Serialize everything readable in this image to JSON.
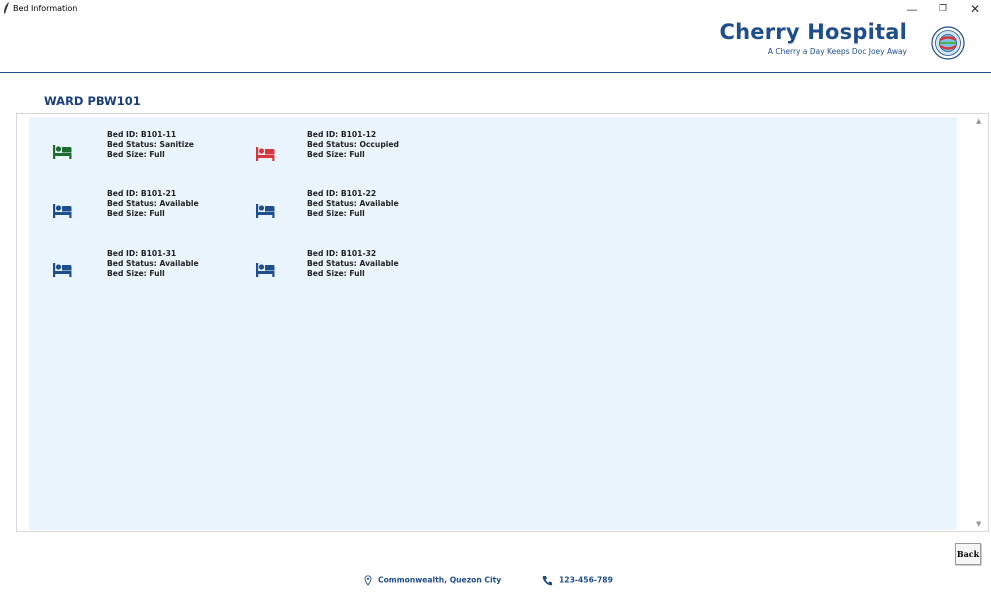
{
  "window": {
    "title": "Bed Information",
    "icons": {
      "app": "feather-icon",
      "minimize": "minimize-icon",
      "maximize": "maximize-icon",
      "close": "close-icon"
    }
  },
  "brand": {
    "name": "Cherry Hospital",
    "tagline": "A Cherry a Day Keeps Doc Joey Away",
    "logo": "hospital-seal-icon"
  },
  "ward": {
    "title": "WARD PBW101"
  },
  "beds": [
    {
      "id_label": "Bed ID: B101-11",
      "status_label": "Bed Status: Sanitize",
      "size_label": "Bed Size: Full",
      "status": "Sanitize",
      "icon": "bed-icon",
      "color": "#1e6b32"
    },
    {
      "id_label": "Bed ID: B101-12",
      "status_label": "Bed Status: Occupied",
      "size_label": "Bed Size: Full",
      "status": "Occupied",
      "icon": "bed-icon",
      "color": "#d8353a"
    },
    {
      "id_label": "Bed ID: B101-21",
      "status_label": "Bed Status: Available",
      "size_label": "Bed Size: Full",
      "status": "Available",
      "icon": "bed-icon",
      "color": "#1f4e8c"
    },
    {
      "id_label": "Bed ID: B101-22",
      "status_label": "Bed Status: Available",
      "size_label": "Bed Size: Full",
      "status": "Available",
      "icon": "bed-icon",
      "color": "#1f4e8c"
    },
    {
      "id_label": "Bed ID: B101-31",
      "status_label": "Bed Status: Available",
      "size_label": "Bed Size: Full",
      "status": "Available",
      "icon": "bed-icon",
      "color": "#1f4e8c"
    },
    {
      "id_label": "Bed ID: B101-32",
      "status_label": "Bed Status: Available",
      "size_label": "Bed Size: Full",
      "status": "Available",
      "icon": "bed-icon",
      "color": "#1f4e8c"
    }
  ],
  "actions": {
    "back_label": "Back"
  },
  "footer": {
    "address": "Commonwealth, Quezon City",
    "phone": "123-456-789",
    "address_icon": "location-pin-icon",
    "phone_icon": "phone-icon"
  },
  "colors": {
    "brand": "#1f4e8c",
    "panel_bg": "#eaf4fc",
    "sanitize": "#1e6b32",
    "occupied": "#d8353a",
    "available": "#1f4e8c"
  }
}
